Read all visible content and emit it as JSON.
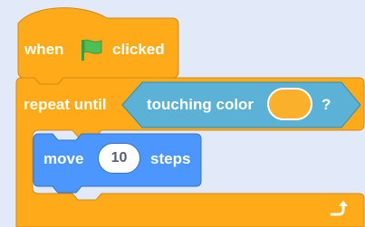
{
  "hat_block": {
    "word_when": "when",
    "flag_icon": "green-flag",
    "word_clicked": "clicked",
    "color": "#ffab19"
  },
  "repeat_block": {
    "label": "repeat until",
    "color": "#ffab19",
    "loop_icon": "loop-arrow"
  },
  "sensing_block": {
    "label": "touching color",
    "swatch_color": "#fbb02b",
    "question_mark": "?",
    "color": "#5cb1d6"
  },
  "motion_block": {
    "word_move": "move",
    "steps_value": "10",
    "word_steps": "steps",
    "color": "#4c97ff"
  }
}
